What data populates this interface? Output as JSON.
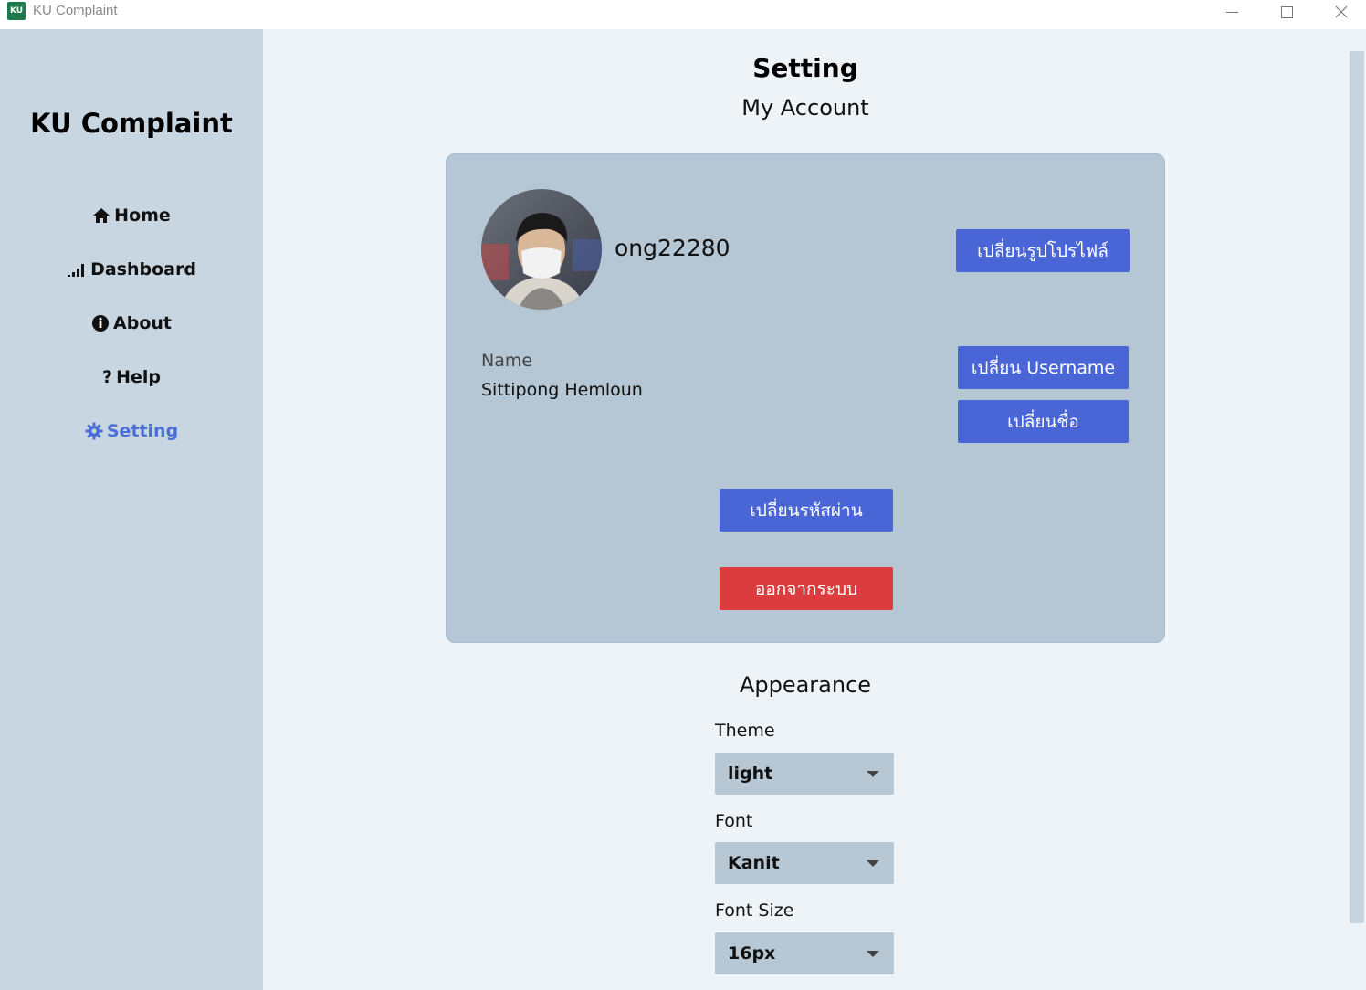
{
  "window": {
    "title": "KU Complaint",
    "icon_text": "KU",
    "controls": [
      "minimize",
      "maximize",
      "close"
    ]
  },
  "sidebar": {
    "brand": "KU Complaint",
    "items": [
      {
        "label": "Home",
        "icon": "home-icon"
      },
      {
        "label": "Dashboard",
        "icon": "signal-bars-icon"
      },
      {
        "label": "About",
        "icon": "info-icon"
      },
      {
        "label": "Help",
        "icon": "question-icon"
      },
      {
        "label": "Setting",
        "icon": "gear-icon",
        "active": true
      }
    ]
  },
  "main": {
    "title": "Setting",
    "account": {
      "heading": "My Account",
      "username": "ong22280",
      "name_label": "Name",
      "name_value": "Sittipong Hemloun",
      "buttons": {
        "change_profile": "เปลี่ยนรูปโปรไฟล์",
        "change_username": "เปลี่ยน Username",
        "change_name": "เปลี่ยนชื่อ",
        "change_password": "เปลี่ยนรหัสผ่าน",
        "logout": "ออกจากระบบ"
      }
    },
    "appearance": {
      "heading": "Appearance",
      "theme_label": "Theme",
      "theme_value": "light",
      "font_label": "Font",
      "font_value": "Kanit",
      "font_size_label": "Font Size",
      "font_size_value": "16px"
    }
  },
  "colors": {
    "sidebar_bg": "#c8d6e1",
    "main_bg": "#eef3f8",
    "card_bg": "#b5c7d4",
    "primary_button": "#4a66d6",
    "danger_button": "#dc3c3f",
    "active_nav": "#4a6fd6"
  }
}
